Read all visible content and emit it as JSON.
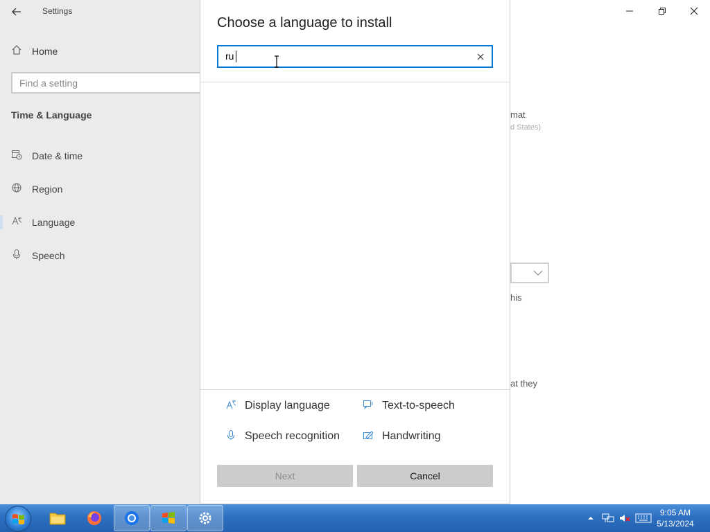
{
  "settings": {
    "app_title": "Settings",
    "home_label": "Home",
    "search_placeholder": "Find a setting",
    "section_title": "Time & Language",
    "nav": [
      {
        "label": "Date & time",
        "icon": "calendar-clock-icon"
      },
      {
        "label": "Region",
        "icon": "globe-icon"
      },
      {
        "label": "Language",
        "icon": "language-icon"
      },
      {
        "label": "Speech",
        "icon": "microphone-icon"
      }
    ],
    "active_nav": "Language",
    "background_fragments": {
      "format_fragment": "mat",
      "region_fragment": "d States)",
      "this_fragment": "his",
      "that_fragment": "at they"
    }
  },
  "dialog": {
    "title": "Choose a language to install",
    "search_value": "ru",
    "features": [
      {
        "label": "Display language",
        "icon": "display-language-icon"
      },
      {
        "label": "Text-to-speech",
        "icon": "text-to-speech-icon"
      },
      {
        "label": "Speech recognition",
        "icon": "microphone-icon"
      },
      {
        "label": "Handwriting",
        "icon": "handwriting-icon"
      }
    ],
    "next_label": "Next",
    "cancel_label": "Cancel"
  },
  "taskbar": {
    "apps": [
      "file-explorer",
      "firefox",
      "chrome",
      "windows-media",
      "settings"
    ],
    "clock_time": "9:05 AM",
    "clock_date": "5/13/2024"
  },
  "colors": {
    "accent": "#0078d7",
    "sidebar_bg": "#ebebeb",
    "button_bg": "#cccccc",
    "taskbar": "#2c6fc0"
  }
}
